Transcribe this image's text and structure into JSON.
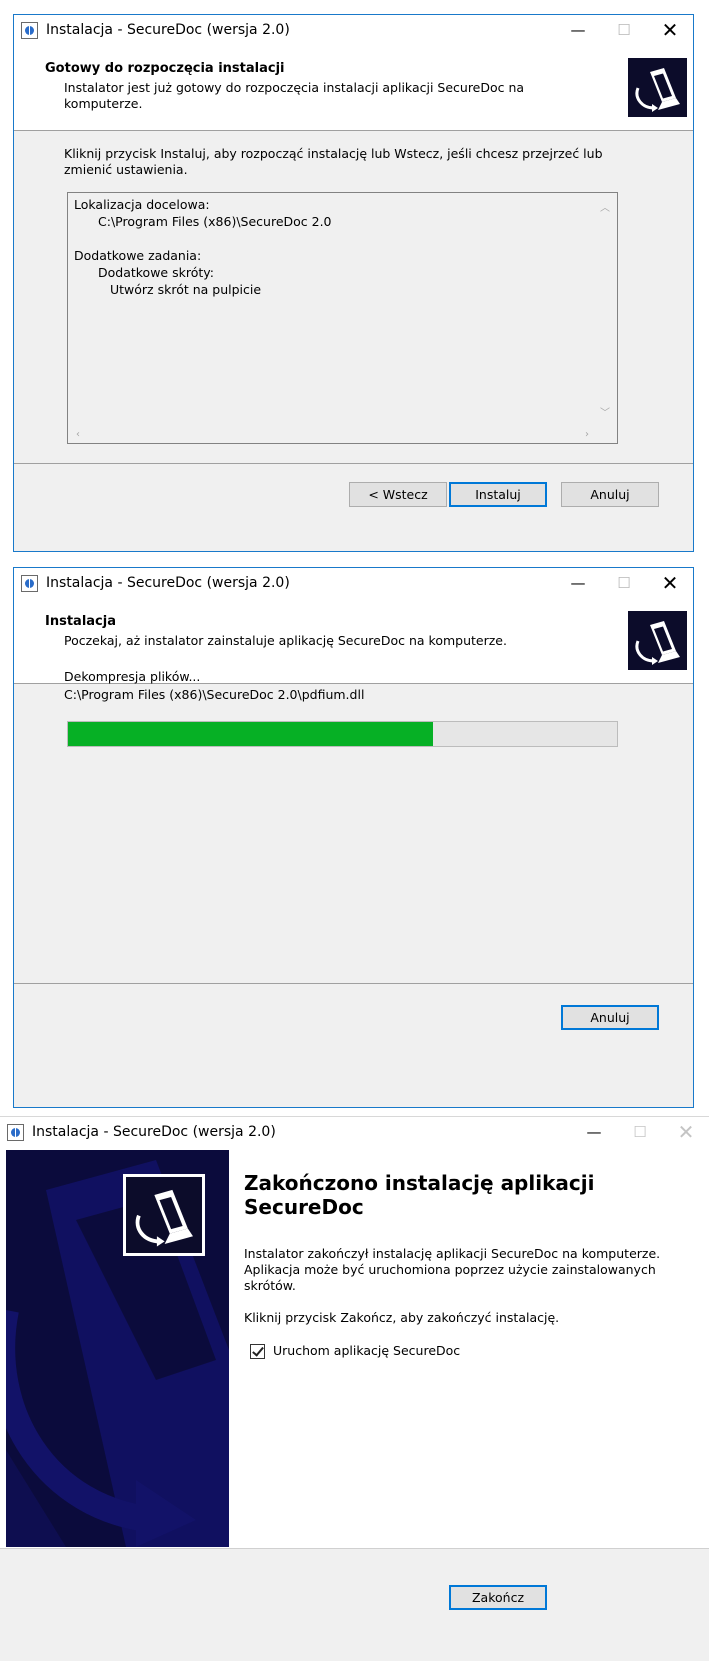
{
  "window_title": "Instalacja - SecureDoc (wersja 2.0)",
  "titlebar_buttons": {
    "minimize": "—",
    "maximize": "☐",
    "close": "✕"
  },
  "step1": {
    "heading": "Gotowy do rozpoczęcia instalacji",
    "subheading": "Instalator jest już gotowy do rozpoczęcia instalacji aplikacji SecureDoc na komputerze.",
    "intro": "Kliknij przycisk Instaluj, aby rozpocząć instalację lub Wstecz, jeśli chcesz przejrzeć lub zmienić ustawienia.",
    "memo": {
      "dest_label": "Lokalizacja docelowa:",
      "dest_value": "C:\\Program Files (x86)\\SecureDoc 2.0",
      "tasks_label": "Dodatkowe zadania:",
      "shortcuts_label": "Dodatkowe skróty:",
      "desktop_shortcut": "Utwórz skrót na pulpicie"
    },
    "buttons": {
      "back": "< Wstecz",
      "install": "Instaluj",
      "cancel": "Anuluj"
    }
  },
  "step2": {
    "heading": "Instalacja",
    "subheading": "Poczekaj, aż instalator zainstaluje aplikację SecureDoc na komputerze.",
    "status": "Dekompresja plików...",
    "current_file": "C:\\Program Files (x86)\\SecureDoc 2.0\\pdfium.dll",
    "progress": 0.665,
    "buttons": {
      "cancel": "Anuluj"
    }
  },
  "step3": {
    "heading": "Zakończono instalację aplikacji SecureDoc",
    "paragraph1": "Instalator zakończył instalację aplikacji SecureDoc na komputerze. Aplikacja może być uruchomiona poprzez użycie zainstalowanych skrótów.",
    "paragraph2": "Kliknij przycisk Zakończ, aby zakończyć instalację.",
    "launch_checkbox_label": "Uruchom aplikację SecureDoc",
    "launch_checked": true,
    "buttons": {
      "finish": "Zakończ"
    }
  },
  "colors": {
    "accent": "#0078d7",
    "progress_fill": "#06b025",
    "wizard_panel": "#0b0b3c"
  },
  "icons": [
    "setup-app-icon",
    "securedoc-logo-icon",
    "scroll-up-arrow-icon",
    "scroll-down-arrow-icon",
    "scroll-left-arrow-icon",
    "scroll-right-arrow-icon",
    "checkmark-icon"
  ]
}
